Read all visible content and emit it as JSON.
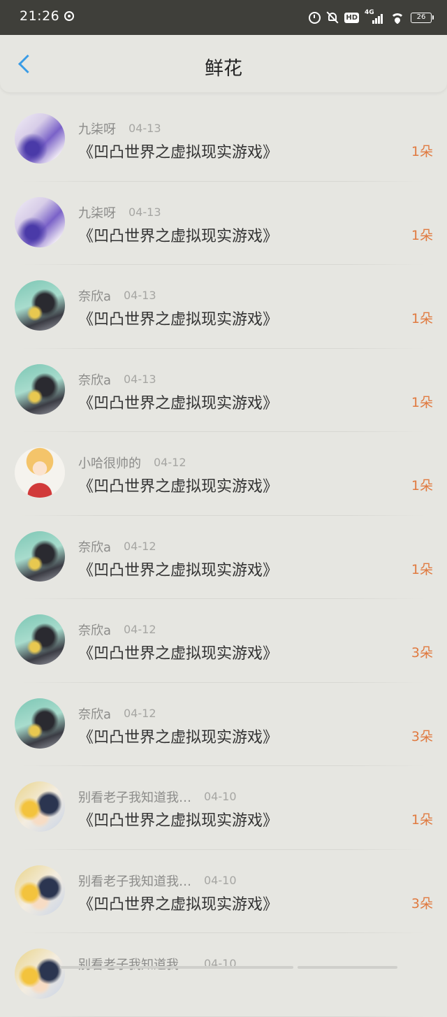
{
  "status_bar": {
    "time": "21:26",
    "battery": "26",
    "network": "4G",
    "hd": "HD"
  },
  "header": {
    "title": "鲜花"
  },
  "flowers": [
    {
      "user": "九柒呀",
      "date": "04-13",
      "book": "《凹凸世界之虚拟现实游戏》",
      "count": "1朵",
      "avatar": "avatar-purple"
    },
    {
      "user": "九柒呀",
      "date": "04-13",
      "book": "《凹凸世界之虚拟现实游戏》",
      "count": "1朵",
      "avatar": "avatar-purple"
    },
    {
      "user": "奈欣a",
      "date": "04-13",
      "book": "《凹凸世界之虚拟现实游戏》",
      "count": "1朵",
      "avatar": "avatar-teal"
    },
    {
      "user": "奈欣a",
      "date": "04-13",
      "book": "《凹凸世界之虚拟现实游戏》",
      "count": "1朵",
      "avatar": "avatar-teal"
    },
    {
      "user": "小哈很帅的",
      "date": "04-12",
      "book": "《凹凸世界之虚拟现实游戏》",
      "count": "1朵",
      "avatar": "avatar-blonde"
    },
    {
      "user": "奈欣a",
      "date": "04-12",
      "book": "《凹凸世界之虚拟现实游戏》",
      "count": "1朵",
      "avatar": "avatar-teal"
    },
    {
      "user": "奈欣a",
      "date": "04-12",
      "book": "《凹凸世界之虚拟现实游戏》",
      "count": "3朵",
      "avatar": "avatar-teal"
    },
    {
      "user": "奈欣a",
      "date": "04-12",
      "book": "《凹凸世界之虚拟现实游戏》",
      "count": "3朵",
      "avatar": "avatar-teal"
    },
    {
      "user": "别看老子我知道我…",
      "date": "04-10",
      "book": "《凹凸世界之虚拟现实游戏》",
      "count": "1朵",
      "avatar": "avatar-anime"
    },
    {
      "user": "别看老子我知道我…",
      "date": "04-10",
      "book": "《凹凸世界之虚拟现实游戏》",
      "count": "3朵",
      "avatar": "avatar-anime"
    },
    {
      "user": "别看老子我知道我…",
      "date": "04-10",
      "book": "",
      "count": "",
      "avatar": "avatar-anime"
    }
  ]
}
